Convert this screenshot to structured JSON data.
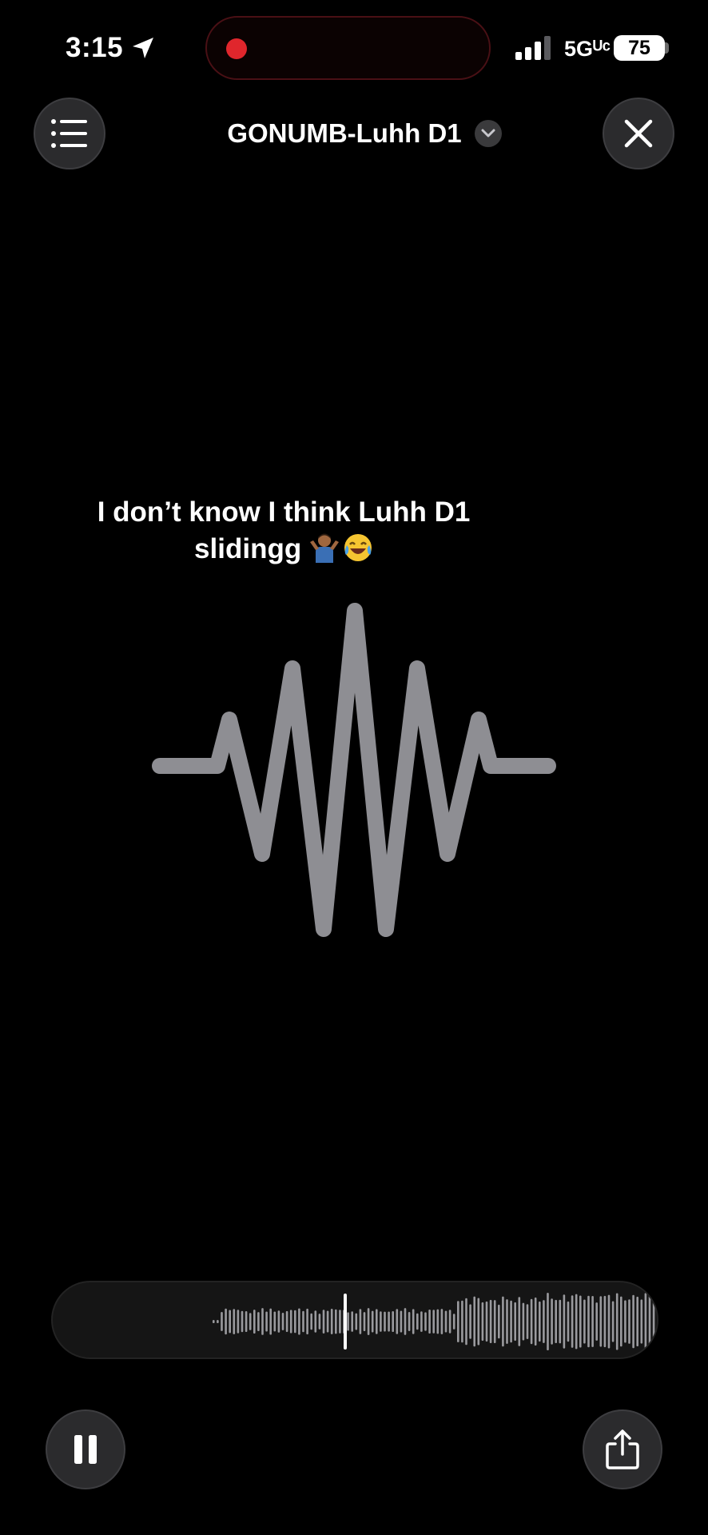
{
  "status_bar": {
    "time": "3:15",
    "network": "5Gᵁᶜ",
    "battery": "75",
    "icons": [
      "location-arrow-icon",
      "recording-dot-icon",
      "signal-bars-icon",
      "battery-icon"
    ]
  },
  "header": {
    "title": "GONUMB-Luhh D1",
    "icons": [
      "list-icon",
      "chevron-down-icon",
      "close-icon"
    ]
  },
  "caption": {
    "line1": "I don’t know I think Luhh D1",
    "line2": "slidingg",
    "emoji": [
      "🤷🏽‍♂️",
      "😂"
    ]
  },
  "colors": {
    "background": "#000000",
    "waveform": "#8e8e93",
    "record_red": "#e0262c",
    "button_bg": "#2b2b2d"
  },
  "playback": {
    "state": "playing",
    "playhead_fraction": 0.48,
    "icons": [
      "pause-icon",
      "share-icon"
    ]
  }
}
